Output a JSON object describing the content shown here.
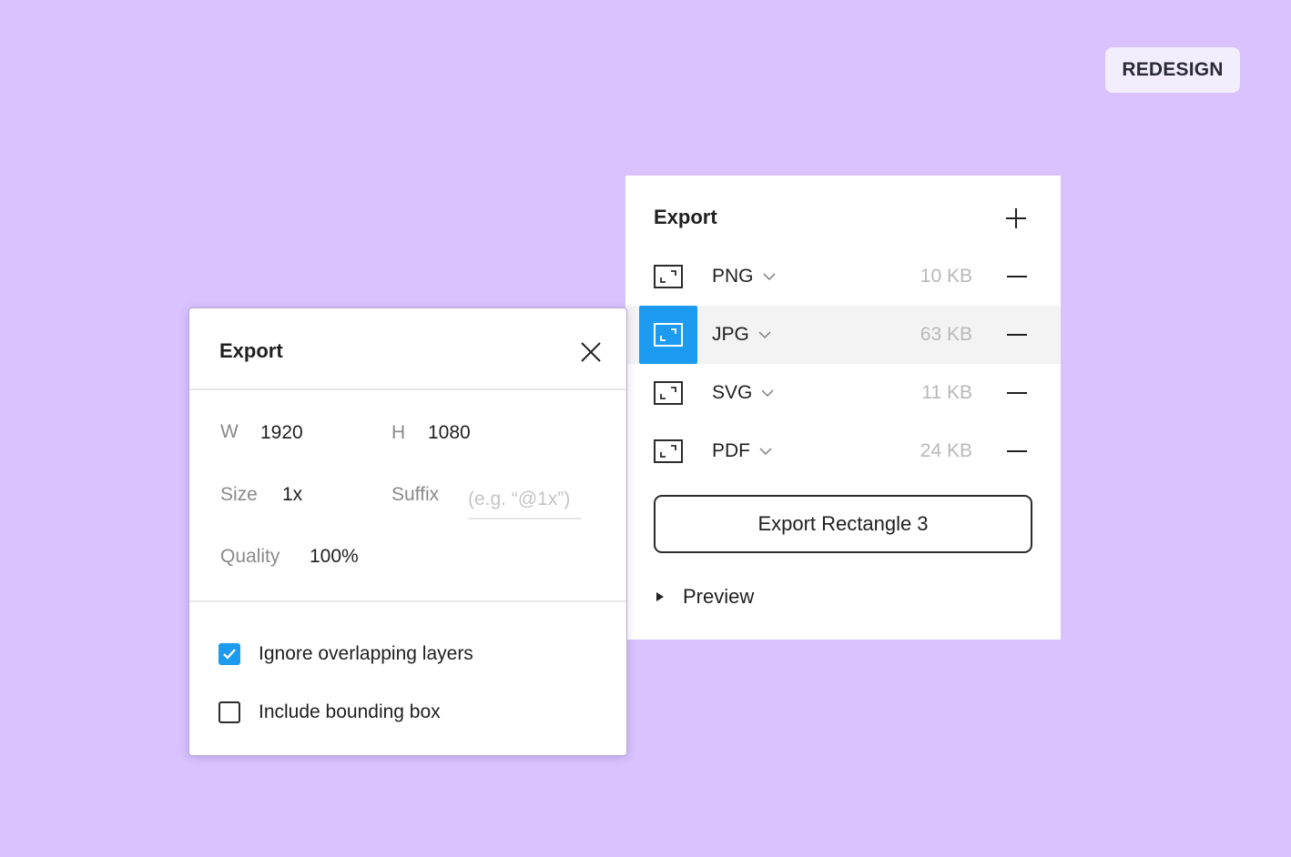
{
  "badge": "REDESIGN",
  "export_panel": {
    "title": "Export",
    "rows": [
      {
        "format": "PNG",
        "size": "10 KB",
        "selected": false
      },
      {
        "format": "JPG",
        "size": "63 KB",
        "selected": true
      },
      {
        "format": "SVG",
        "size": "11 KB",
        "selected": false
      },
      {
        "format": "PDF",
        "size": "24 KB",
        "selected": false
      }
    ],
    "export_button": "Export Rectangle 3",
    "preview_label": "Preview"
  },
  "export_dialog": {
    "title": "Export",
    "width_label": "W",
    "width_value": "1920",
    "height_label": "H",
    "height_value": "1080",
    "size_label": "Size",
    "size_value": "1x",
    "suffix_label": "Suffix",
    "suffix_placeholder": "(e.g. “@1x”)",
    "quality_label": "Quality",
    "quality_value": "100%",
    "options": [
      {
        "label": "Ignore overlapping layers",
        "checked": true
      },
      {
        "label": "Include bounding box",
        "checked": false
      }
    ]
  },
  "colors": {
    "background": "#d9c2fd",
    "accent": "#1c9bf0",
    "badge_bg": "#f3eefe"
  }
}
